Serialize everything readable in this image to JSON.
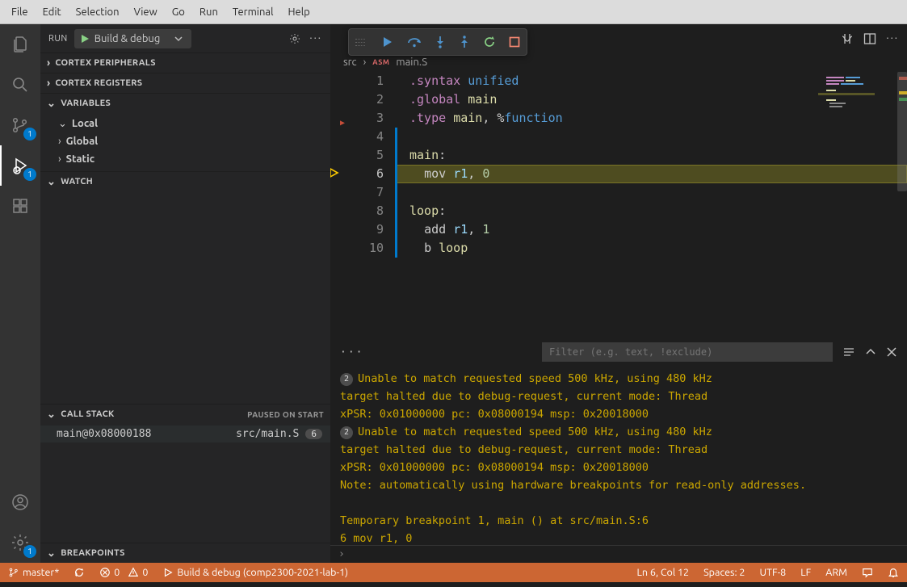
{
  "menu": {
    "file": "File",
    "edit": "Edit",
    "selection": "Selection",
    "view": "View",
    "go": "Go",
    "run": "Run",
    "terminal": "Terminal",
    "help": "Help"
  },
  "activity": {
    "scm_badge": "1",
    "debug_badge": "1",
    "settings_badge": "1"
  },
  "run_header": {
    "label": "RUN",
    "config": "Build & debug"
  },
  "sections": {
    "cortex_peripherals": "CORTEX PERIPHERALS",
    "cortex_registers": "CORTEX REGISTERS",
    "variables": "VARIABLES",
    "watch": "WATCH",
    "callstack": "CALL STACK",
    "paused": "PAUSED ON START",
    "breakpoints": "BREAKPOINTS"
  },
  "variables": {
    "local": "Local",
    "global": "Global",
    "static": "Static"
  },
  "callstack": {
    "frame": "main@0x08000188",
    "src": "src/main.S",
    "line": "6"
  },
  "breadcrumb": {
    "folder": "src",
    "file": "main.S",
    "asm": "ASM"
  },
  "code": {
    "lines": {
      "1": ".syntax unified",
      "2": ".global main",
      "3": ".type main, %function",
      "4": "",
      "5": "main:",
      "6": "  mov r1, 0",
      "7": "",
      "8": "loop:",
      "9": "  add r1, 1",
      "10": "  b loop"
    }
  },
  "panel": {
    "filter_placeholder": "Filter (e.g. text, !exclude)",
    "l1": "Unable to match requested speed 500 kHz, using 480 kHz",
    "l2": "target halted due to debug-request, current mode: Thread",
    "l3": "xPSR: 0x01000000 pc: 0x08000194 msp: 0x20018000",
    "l4": "Unable to match requested speed 500 kHz, using 480 kHz",
    "l5": "target halted due to debug-request, current mode: Thread",
    "l6": "xPSR: 0x01000000 pc: 0x08000194 msp: 0x20018000",
    "l7": "Note: automatically using hardware breakpoints for read-only addresses.",
    "l8": "Temporary breakpoint 1, main () at src/main.S:6",
    "l9": "6         mov r1, 0",
    "chip": "2"
  },
  "status": {
    "branch": "master*",
    "errors": "0",
    "warnings": "0",
    "task": "Build & debug (comp2300-2021-lab-1)",
    "position": "Ln 6, Col 12",
    "spaces": "Spaces: 2",
    "encoding": "UTF-8",
    "eol": "LF",
    "lang": "ARM"
  }
}
